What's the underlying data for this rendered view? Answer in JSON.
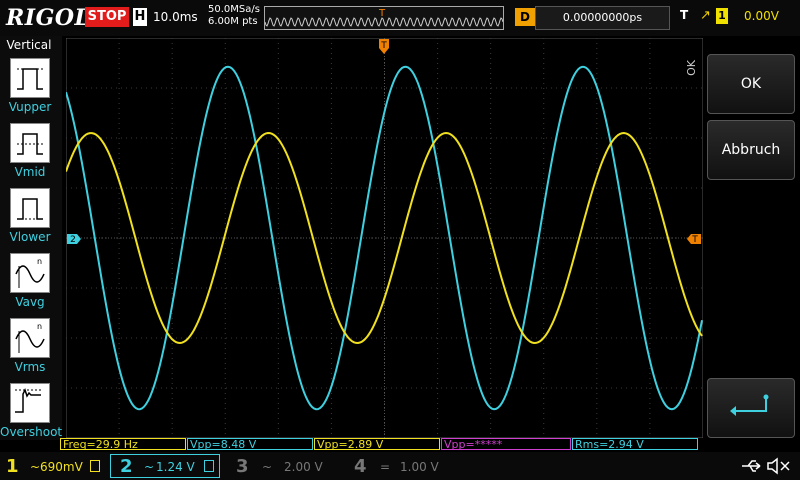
{
  "header": {
    "logo": "RIGOL",
    "run_state": "STOP",
    "timebase_label": "H",
    "timebase": "10.0ms",
    "sample_rate": "50.0MSa/s",
    "memory_depth": "6.00M pts",
    "delay_label": "D",
    "delay": "0.00000000ps",
    "trigger_label": "T",
    "trigger_source": "1",
    "trigger_level": "0.00V"
  },
  "left_menu": {
    "title": "Vertical",
    "items": [
      {
        "label": "Vupper",
        "icon": "vupper-icon"
      },
      {
        "label": "Vmid",
        "icon": "vmid-icon"
      },
      {
        "label": "Vlower",
        "icon": "vlower-icon"
      },
      {
        "label": "Vavg",
        "icon": "vavg-icon"
      },
      {
        "label": "Vrms",
        "icon": "vrms-icon"
      },
      {
        "label": "Overshoot",
        "icon": "overshoot-icon"
      }
    ]
  },
  "right_menu": {
    "side_label": "OK",
    "ok_label": "OK",
    "cancel_label": "Abbruch"
  },
  "markers": {
    "ch2_level": "2",
    "trigger_level": "T",
    "trigger_pos": "T"
  },
  "measurements": [
    {
      "text": "Freq=29.9 Hz",
      "color": "#f0e020"
    },
    {
      "text": "Vpp=8.48 V",
      "color": "#3fd0e0"
    },
    {
      "text": "Vpp=2.89 V",
      "color": "#f0e020"
    },
    {
      "text": "Vpp=*****",
      "color": "#d040d0"
    },
    {
      "text": "Rms=2.94 V",
      "color": "#3fd0e0"
    }
  ],
  "channels": [
    {
      "num": "1",
      "coupling": "~",
      "scale": "690mV",
      "color": "#f0e020",
      "active": true
    },
    {
      "num": "2",
      "coupling": "~",
      "scale": "1.24 V",
      "color": "#3fd0e0",
      "active": true
    },
    {
      "num": "3",
      "coupling": "~",
      "scale": "2.00 V",
      "color": "#777777",
      "active": false
    },
    {
      "num": "4",
      "coupling": "=",
      "scale": "1.00 V",
      "color": "#777777",
      "active": false
    }
  ],
  "waveforms": {
    "frequency_hz": 29.9,
    "ch1": {
      "color": "#f0e020",
      "vpp_div": 4.2
    },
    "ch2": {
      "color": "#3fd0e0",
      "vpp_div": 6.85
    }
  }
}
